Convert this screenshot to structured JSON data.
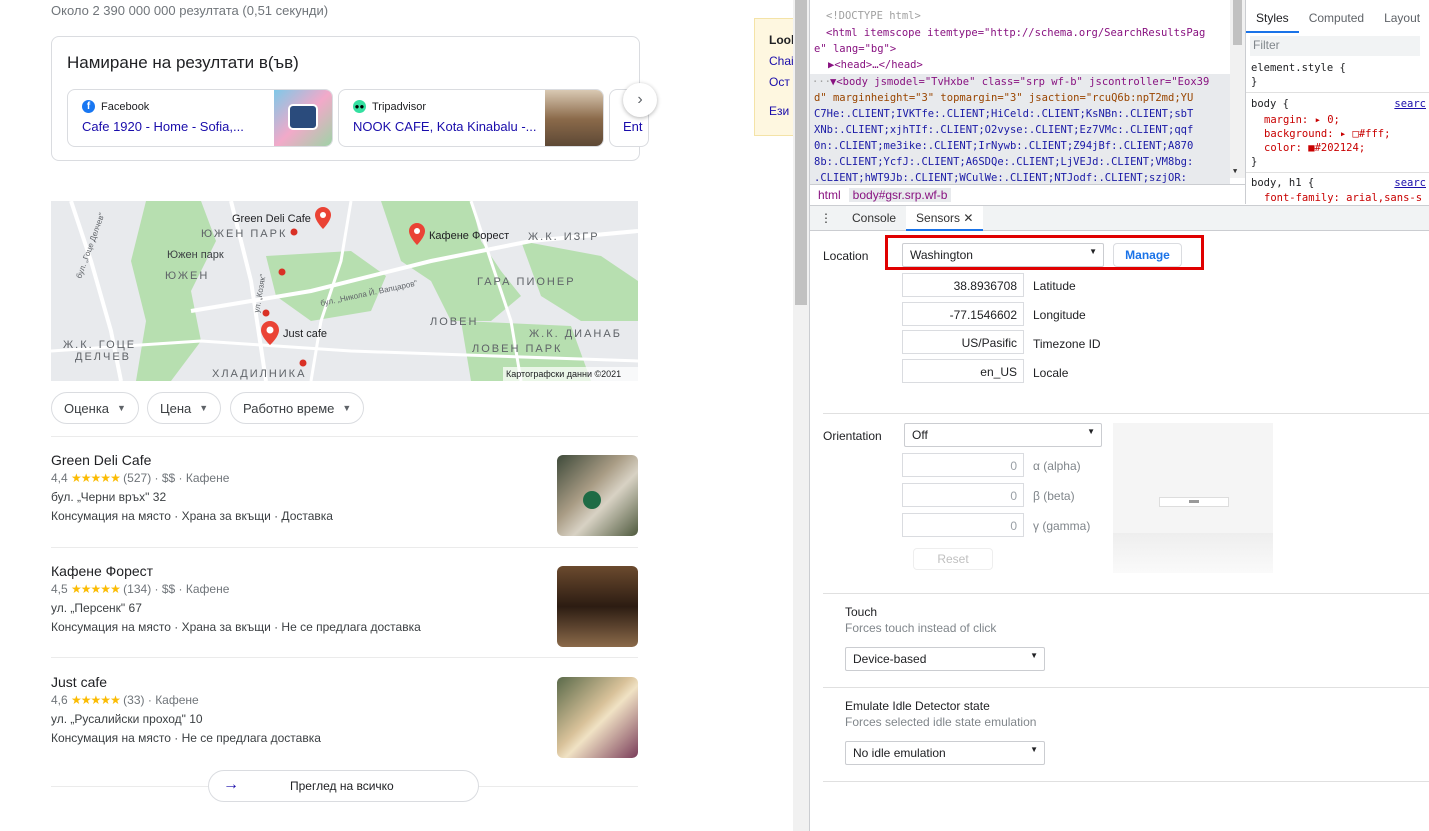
{
  "results_stats": "Около 2 390 000 000 резултата (0,51 секунди)",
  "find_results": {
    "title": "Намиране на резултати в(ъв)",
    "items": [
      {
        "source": "Facebook",
        "link": "Cafe 1920 - Home - Sofia,...",
        "icon": "facebook-icon",
        "color": "#1877f2"
      },
      {
        "source": "Tripadvisor",
        "link": "NOOK CAFE, Kota Kinabalu -...",
        "icon": "tripadvisor-icon",
        "color": "#34e0a1"
      },
      {
        "link": "Ent"
      }
    ],
    "next_icon": "chevron-right-icon"
  },
  "map": {
    "labels": {
      "green_deli": "Green Deli Cafe",
      "forest": "Кафене Форест",
      "just_cafe": "Just cafe",
      "yuzhen_park1": "ЮЖЕН ПАРК",
      "yuzhen_park2": "Южен парк",
      "yuzhen": "ЮЖЕН",
      "izgrev": "Ж.К. ИЗГР",
      "gara_pioner": "ГАРА ПИОНЕР",
      "loven": "ЛОВЕН",
      "dianabad": "Ж.К. ДИАНАБ",
      "loven_park": "ЛОВЕН ПАРК",
      "gotse_delchev1": "Ж.К. ГОЦЕ",
      "gotse_delchev2": "ДЕЛЧЕВ",
      "hladilnika": "ХЛАДИЛНИКА",
      "vaptsarov": "бул. „Никола Й. Вапцаров\"",
      "kozyak": "ул. „Козяк\"",
      "gotse_blvd": "бул. „Гоце Делчев\"",
      "copyright": "Картографски данни ©2021"
    }
  },
  "filters": [
    {
      "label": "Оценка",
      "name": "filter-rating"
    },
    {
      "label": "Цена",
      "name": "filter-price"
    },
    {
      "label": "Работно време",
      "name": "filter-hours"
    }
  ],
  "places": [
    {
      "name": "Green Deli Cafe",
      "rating": "4,4",
      "stars": "★★★★★",
      "reviews": "(527)",
      "price": "$$",
      "type": "Кафене",
      "address": "бул. „Черни връх\" 32",
      "features": "Консумация на място · Храна за вкъщи · Доставка"
    },
    {
      "name": "Кафене Форест",
      "rating": "4,5",
      "stars": "★★★★★",
      "reviews": "(134)",
      "price": "$$",
      "type": "Кафене",
      "address": "ул. „Персенк\" 67",
      "features": "Консумация на място · Храна за вкъщи · Не се предлага доставка"
    },
    {
      "name": "Just cafe",
      "rating": "4,6",
      "stars": "★★★★★",
      "reviews": "(33)",
      "price": "",
      "type": "Кафене",
      "address": "ул. „Русалийски проход\" 10",
      "features": "Консумация на място · Не се предлага доставка"
    }
  ],
  "view_all": "Преглед на всичко",
  "side_panel": [
    "Look",
    "Chai",
    "Ост",
    "Ези"
  ],
  "devtools": {
    "elements": {
      "doctype": "<!DOCTYPE html>",
      "html_open": "<html itemscope itemtype=\"http://schema.org/SearchResultsPag",
      "html_open2": "e\" lang=\"bg\">",
      "head": "▶<head>…</head>",
      "body1": "▼<body jsmodel=\"TvHxbe\" class=\"srp wf-b\" jscontroller=\"Eox39",
      "body2": "d\" marginheight=\"3\" topmargin=\"3\" jsaction=\"rcuQ6b:npT2md;YU",
      "body3": "C7He:.CLIENT;IVKTfe:.CLIENT;HiCeld:.CLIENT;KsNBn:.CLIENT;sbT",
      "body4": "XNb:.CLIENT;xjhTIf:.CLIENT;O2vyse:.CLIENT;Ez7VMc:.CLIENT;qqf",
      "body5": "0n:.CLIENT;me3ike:.CLIENT;IrNywb:.CLIENT;Z94jBf:.CLIENT;A870",
      "body6": "8b:.CLIENT;YcfJ:.CLIENT;A6SDQe:.CLIENT;LjVEJd:.CLIENT;VM8bg:",
      "body7": ".CLIENT;hWT9Jb:.CLIENT;WCulWe:.CLIENT;NTJodf:.CLIENT;szjOR:"
    },
    "breadcrumbs": [
      "html",
      "body#gsr.srp.wf-b"
    ],
    "styles_tabs": [
      "Styles",
      "Computed",
      "Layout"
    ],
    "filter_placeholder": "Filter",
    "styles_lines": [
      "element.style {",
      "}",
      "body {",
      "margin: ▸ 0;",
      "background: ▸ □#fff;",
      "color: ■#202124;",
      "}",
      "body, h1 {",
      "font-family: arial,sans-s"
    ],
    "styles_source": "searc",
    "drawer_tabs": [
      "Console",
      "Sensors"
    ],
    "sensors": {
      "location_label": "Location",
      "location_value": "Washington",
      "manage": "Manage",
      "latitude": "38.8936708",
      "latitude_label": "Latitude",
      "longitude": "-77.1546602",
      "longitude_label": "Longitude",
      "timezone": "US/Pasific",
      "timezone_label": "Timezone ID",
      "locale": "en_US",
      "locale_label": "Locale",
      "orientation_label": "Orientation",
      "orientation_value": "Off",
      "alpha": "0",
      "alpha_label": "α (alpha)",
      "beta": "0",
      "beta_label": "β (beta)",
      "gamma": "0",
      "gamma_label": "γ (gamma)",
      "reset": "Reset",
      "touch_title": "Touch",
      "touch_desc": "Forces touch instead of click",
      "touch_value": "Device-based",
      "idle_title": "Emulate Idle Detector state",
      "idle_desc": "Forces selected idle state emulation",
      "idle_value": "No idle emulation"
    },
    "highlight_color": "#e00000"
  }
}
